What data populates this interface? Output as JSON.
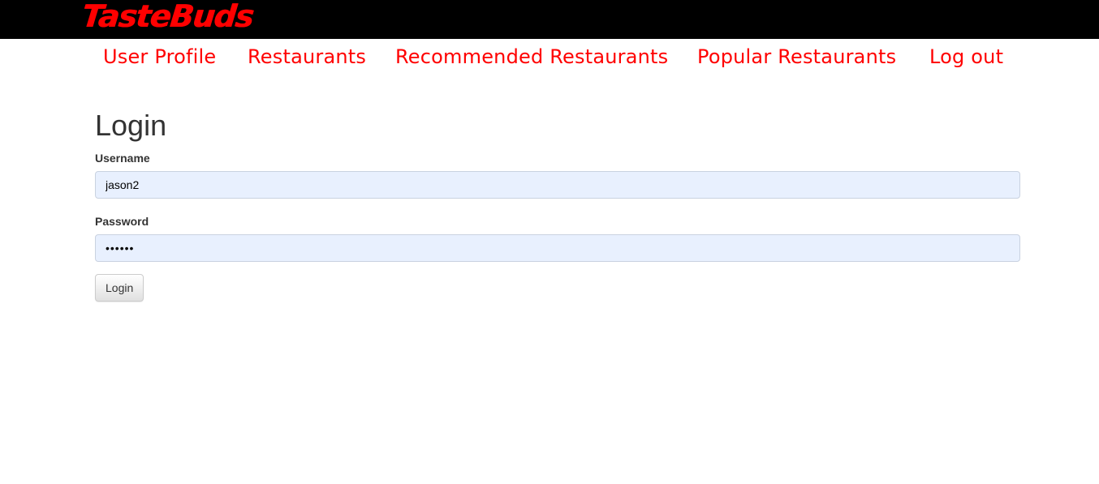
{
  "header": {
    "logo_text": "TasteBuds"
  },
  "nav": {
    "items": [
      {
        "label": "User Profile"
      },
      {
        "label": "Restaurants"
      },
      {
        "label": "Recommended Restaurants"
      },
      {
        "label": "Popular Restaurants"
      },
      {
        "label": "Log out"
      }
    ]
  },
  "login_form": {
    "title": "Login",
    "username_label": "Username",
    "username_value": "jason2",
    "password_label": "Password",
    "password_mask": "••••••",
    "submit_label": "Login"
  },
  "colors": {
    "brand": "#ff0000",
    "topbar": "#000000",
    "autofill_bg": "#e8f0fe"
  }
}
